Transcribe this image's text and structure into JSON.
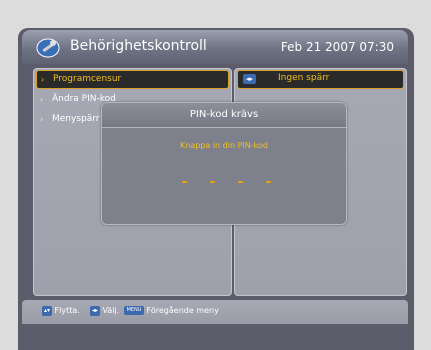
{
  "header": {
    "title": "Behörighetskontroll",
    "datetime": "Feb 21 2007 07:30",
    "logo_icon": "key-logo-icon"
  },
  "menu": {
    "items": [
      {
        "label": "Programcensur",
        "selected": true
      },
      {
        "label": "Ändra PIN-kod",
        "selected": false
      },
      {
        "label": "Menyspärr",
        "selected": false
      }
    ]
  },
  "value_panel": {
    "value": "Ingen spärr",
    "icon": "left-right-arrows-icon"
  },
  "dialog": {
    "title": "PIN-kod krävs",
    "prompt": "Knappa in din PIN-kod",
    "pin_digits_entered": 0,
    "pin_length": 4
  },
  "footer": {
    "move_label": "Flytta.",
    "select_label": "Välj.",
    "menu_key_label": "MENU",
    "previous_menu_label": "Föregående meny"
  },
  "colors": {
    "accent_text": "#f2c020",
    "selection_border": "#d8a020",
    "key_blue": "#3c6ab0"
  }
}
